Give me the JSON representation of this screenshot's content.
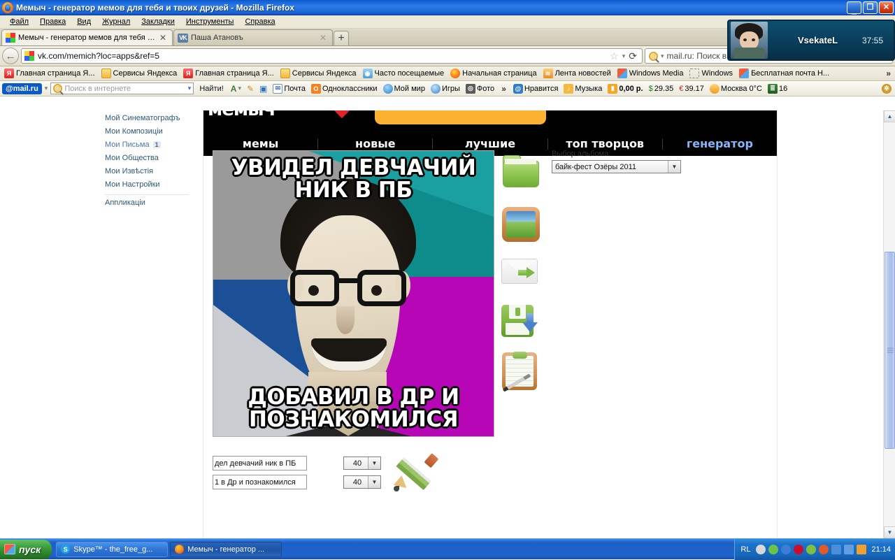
{
  "window": {
    "title": "Мемыч - генератор мемов для тебя и твоих друзей - Mozilla Firefox",
    "minimize": "_",
    "restore": "❐",
    "close": "✕"
  },
  "menubar": [
    {
      "label": "Файл"
    },
    {
      "label": "Правка"
    },
    {
      "label": "Вид"
    },
    {
      "label": "Журнал"
    },
    {
      "label": "Закладки"
    },
    {
      "label": "Инструменты"
    },
    {
      "label": "Справка"
    }
  ],
  "tabs": [
    {
      "label": "Мемыч - генератор мемов для тебя и т...",
      "close": "✕",
      "active": true
    },
    {
      "label": "Паша Атановъ",
      "close": "✕",
      "active": false
    }
  ],
  "newtab_label": "+",
  "urlbar": {
    "back": "←",
    "url": "vk.com/memich?loc=apps&ref=5",
    "star": "☆",
    "caret": "▾",
    "reload": "⟳",
    "search_text": "mail.ru: Поиск в Инт",
    "search_caret": "▾"
  },
  "bookmarks": [
    {
      "label": "Главная страница Я...",
      "icon": "yandex-icon"
    },
    {
      "label": "Сервисы Яндекса",
      "icon": "folder-icon"
    },
    {
      "label": "Главная страница Я...",
      "icon": "yandex-icon"
    },
    {
      "label": "Сервисы Яндекса",
      "icon": "folder-icon"
    },
    {
      "label": "Часто посещаемые",
      "icon": "history-icon"
    },
    {
      "label": "Начальная страница",
      "icon": "firefox-icon"
    },
    {
      "label": "Лента новостей",
      "icon": "rss-icon"
    },
    {
      "label": "Windows Media",
      "icon": "windows-icon"
    },
    {
      "label": "Windows",
      "icon": "dashed-icon"
    },
    {
      "label": "Бесплатная почта Н...",
      "icon": "windows-icon"
    }
  ],
  "bookmarks_overflow": "»",
  "mailbar": {
    "logo": "@mail.ru",
    "logo_caret": "▾",
    "search_placeholder": "Поиск в интернете",
    "search_caret": "▾",
    "find_button": "Найти!",
    "tool_icons": [
      {
        "name": "font-size-icon",
        "glyph": "A"
      },
      {
        "name": "highlighter-icon",
        "glyph": "✎"
      },
      {
        "name": "screenshot-icon",
        "glyph": "▣"
      }
    ],
    "items": [
      {
        "label": "Почта",
        "icon": "mail-icon"
      },
      {
        "label": "Одноклассники",
        "icon": "odnoklassniki-icon"
      },
      {
        "label": "Мой мир",
        "icon": "my-world-icon"
      },
      {
        "label": "Игры",
        "icon": "games-icon"
      },
      {
        "label": "Фото",
        "icon": "photo-icon"
      }
    ],
    "overflow": "»",
    "items2": [
      {
        "label": "Нравится",
        "icon": "like-icon"
      },
      {
        "label": "Музыка",
        "icon": "music-icon"
      },
      {
        "label": "0,00 р.",
        "icon": "wallet-icon"
      },
      {
        "label": "29.35",
        "icon": "usd-icon",
        "prefix": "$"
      },
      {
        "label": "39.17",
        "icon": "eur-icon",
        "prefix": "€"
      },
      {
        "label": "Москва 0°C",
        "icon": "weather-icon"
      },
      {
        "label": "16",
        "icon": "traffic-icon"
      }
    ],
    "settings_icon": "gear-icon"
  },
  "vk_sidebar": {
    "items": [
      {
        "label": "Мой Синематографъ",
        "badge": null
      },
      {
        "label": "Мои Композиціи",
        "badge": null
      },
      {
        "label": "Мои Письма",
        "badge": "1"
      },
      {
        "label": "Мои Общества",
        "badge": null
      },
      {
        "label": "Мои Извѣстія",
        "badge": null
      },
      {
        "label": "Мои Настройки",
        "badge": null
      }
    ],
    "apps_label": "Аппликаціи"
  },
  "app": {
    "logo": "мемыч",
    "nav": [
      {
        "label": "мемы",
        "active": false
      },
      {
        "label": "новые",
        "active": false
      },
      {
        "label": "лучшие",
        "active": false
      },
      {
        "label": "топ творцов",
        "active": false
      },
      {
        "label": "генератор",
        "active": true
      }
    ],
    "meme": {
      "top_text": "УВИДЕЛ ДЕВЧАЧИЙ НИК В ПБ",
      "bottom_text": "ДОБАВИЛ В ДР И ПОЗНАКОМИЛСЯ"
    },
    "toolbar_icons": [
      {
        "name": "open-folder-icon",
        "title": "Открыть"
      },
      {
        "name": "picture-icon",
        "title": "Изображение"
      },
      {
        "name": "send-envelope-icon",
        "title": "Отправить"
      },
      {
        "name": "save-disk-icon",
        "title": "Сохранить"
      },
      {
        "name": "clipboard-edit-icon",
        "title": "Редактировать"
      }
    ],
    "album": {
      "label": "Выбор альбома:",
      "selected": "байк-фест Озёры 2011",
      "caret": "▼"
    },
    "rows": [
      {
        "text": "дел девчачий ник в ПБ",
        "size": "40",
        "caret": "▼"
      },
      {
        "text": "1 в Др и познакомился",
        "size": "40",
        "caret": "▼"
      }
    ],
    "pencil_icon": "pencil-icon"
  },
  "scrollbar": {
    "up": "▲",
    "down": "▼"
  },
  "skype": {
    "name": "VsekateL",
    "timer": "37:55"
  },
  "taskbar": {
    "start": "пуск",
    "tasks": [
      {
        "label": "Skype™ - the_free_g...",
        "icon": "skype-icon",
        "active": false
      },
      {
        "label": "Мемыч - генератор ...",
        "icon": "firefox-icon",
        "active": true
      }
    ],
    "lang": "RL",
    "clock": "21:14",
    "tray_icons": [
      {
        "name": "safely-remove-icon",
        "color": "#d8d8d8"
      },
      {
        "name": "shield-ok-icon",
        "color": "#6cc24a"
      },
      {
        "name": "download-icon",
        "color": "#3a7fd5"
      },
      {
        "name": "kaspersky-icon",
        "color": "#c8102e"
      },
      {
        "name": "update-icon",
        "color": "#7dbf3f"
      },
      {
        "name": "warning-icon",
        "color": "#e05a2b"
      },
      {
        "name": "network-icon",
        "color": "#4a90d9"
      },
      {
        "name": "monitor-icon",
        "color": "#5f9ee0"
      },
      {
        "name": "volume-icon",
        "color": "#f0a030"
      }
    ]
  }
}
